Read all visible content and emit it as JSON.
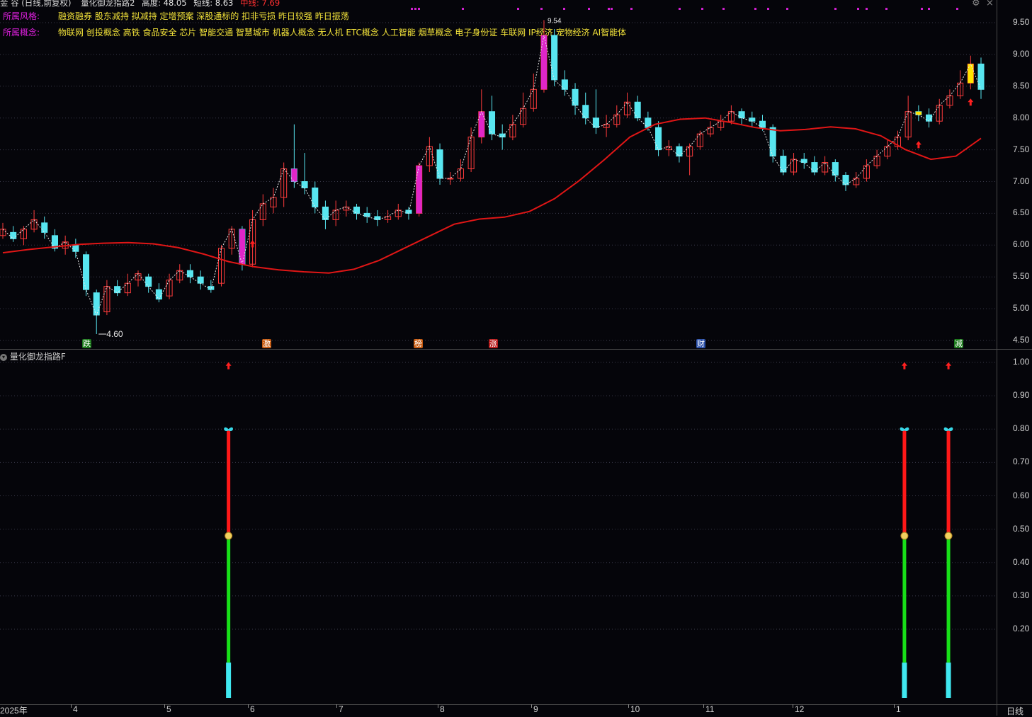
{
  "header": {
    "stock": "金 谷 (日线,前复权)",
    "indicator": "量化御龙指路2",
    "height_label": "高度: 48.05",
    "short_label": "短线: 8.63",
    "mid_label": "中线: 7.69"
  },
  "style_row": {
    "label": "所属风格:",
    "text": "融资融券 股东减持 拟减持 定增预案 深股通标的 扣非亏损 昨日较强 昨日振荡"
  },
  "concept_row": {
    "label": "所属概念:",
    "text": "物联网 创投概念 高铁 食品安全 芯片 智能交通 智慧城市 机器人概念 无人机 ETC概念 人工智能 烟草概念 电子身份证 车联网 IP经济 宠物经济 AI智能体"
  },
  "lower_panel": {
    "title": "量化御龙指路F"
  },
  "price_axis": {
    "ticks": [
      "9.50",
      "9.00",
      "8.50",
      "8.00",
      "7.50",
      "7.00",
      "6.50",
      "6.00",
      "5.50",
      "5.00",
      "4.50"
    ]
  },
  "indicator_axis": {
    "ticks": [
      "1.00",
      "0.90",
      "0.80",
      "0.70",
      "0.60",
      "0.50",
      "0.40",
      "0.30",
      "0.20"
    ]
  },
  "date_axis": {
    "labels": [
      "2025年",
      "4",
      "5",
      "6",
      "7",
      "8",
      "9",
      "10",
      "11",
      "12",
      "1"
    ]
  },
  "period": "日线",
  "low_marker": "4.60",
  "high_marker": "9.54",
  "events": [
    {
      "text": "跌",
      "color": "#1c7a1c"
    },
    {
      "text": "激",
      "color": "#c65a10"
    },
    {
      "text": "榜",
      "color": "#c65a10"
    },
    {
      "text": "涨",
      "color": "#b81a1a"
    },
    {
      "text": "财",
      "color": "#2a4fa8"
    },
    {
      "text": "减",
      "color": "#1c7a1c"
    }
  ],
  "colors": {
    "up": "#ff3b3b",
    "down": "#58e6f0",
    "ma": "#e01616",
    "label": "#e020e0",
    "info": "#f2e23a",
    "grid": "#3a3a4a"
  },
  "icons": [
    "gear-icon",
    "close-icon",
    "chevron-down-icon",
    "arrow-up-icon",
    "butterfly-icon",
    "money-bag-icon"
  ],
  "chart_data": {
    "type": "candlestick",
    "ylim": [
      4.45,
      9.75
    ],
    "ma_ylim": [
      4.45,
      9.75
    ],
    "ma": [
      5.88,
      5.93,
      5.97,
      6.01,
      6.03,
      6.04,
      6.02,
      5.96,
      5.86,
      5.74,
      5.66,
      5.61,
      5.58,
      5.56,
      5.62,
      5.76,
      5.95,
      6.14,
      6.33,
      6.41,
      6.44,
      6.53,
      6.73,
      7.02,
      7.35,
      7.7,
      7.9,
      7.98,
      8.0,
      7.93,
      7.85,
      7.8,
      7.82,
      7.86,
      7.83,
      7.72,
      7.5,
      7.35,
      7.4,
      7.68
    ],
    "candles": [
      [
        6.15,
        6.25,
        6.35,
        6.1
      ],
      [
        6.2,
        6.1,
        6.3,
        6.05
      ],
      [
        6.1,
        6.25,
        6.3,
        6.0
      ],
      [
        6.25,
        6.4,
        6.55,
        6.2
      ],
      [
        6.35,
        6.2,
        6.45,
        6.1
      ],
      [
        6.15,
        5.95,
        6.25,
        5.9
      ],
      [
        5.95,
        6.05,
        6.15,
        5.85
      ],
      [
        6.0,
        5.9,
        6.1,
        5.8
      ],
      [
        5.85,
        5.3,
        5.9,
        5.2
      ],
      [
        5.25,
        4.9,
        5.3,
        4.6
      ],
      [
        4.95,
        5.35,
        5.45,
        4.9
      ],
      [
        5.35,
        5.25,
        5.45,
        5.2
      ],
      [
        5.25,
        5.4,
        5.55,
        5.2
      ],
      [
        5.45,
        5.55,
        5.6,
        5.35
      ],
      [
        5.5,
        5.35,
        5.55,
        5.25
      ],
      [
        5.3,
        5.15,
        5.4,
        5.1
      ],
      [
        5.2,
        5.45,
        5.55,
        5.15
      ],
      [
        5.45,
        5.6,
        5.7,
        5.4
      ],
      [
        5.6,
        5.5,
        5.7,
        5.4
      ],
      [
        5.5,
        5.4,
        5.6,
        5.3
      ],
      [
        5.35,
        5.3,
        5.45,
        5.25
      ],
      [
        5.4,
        5.95,
        6.0,
        5.35
      ],
      [
        5.95,
        6.25,
        6.3,
        5.85
      ],
      [
        6.25,
        5.7,
        6.3,
        5.6
      ],
      [
        5.7,
        6.4,
        6.55,
        5.65
      ],
      [
        6.4,
        6.65,
        6.8,
        6.3
      ],
      [
        6.6,
        6.75,
        6.9,
        6.5
      ],
      [
        6.75,
        7.2,
        7.3,
        6.6
      ],
      [
        7.2,
        7.0,
        7.9,
        6.9
      ],
      [
        7.0,
        6.9,
        7.45,
        6.8
      ],
      [
        6.9,
        6.6,
        7.0,
        6.5
      ],
      [
        6.6,
        6.4,
        6.7,
        6.25
      ],
      [
        6.4,
        6.55,
        6.7,
        6.3
      ],
      [
        6.55,
        6.6,
        6.7,
        6.45
      ],
      [
        6.6,
        6.5,
        6.65,
        6.4
      ],
      [
        6.5,
        6.45,
        6.6,
        6.35
      ],
      [
        6.45,
        6.4,
        6.55,
        6.3
      ],
      [
        6.4,
        6.45,
        6.55,
        6.35
      ],
      [
        6.45,
        6.55,
        6.65,
        6.4
      ],
      [
        6.55,
        6.5,
        6.6,
        6.4
      ],
      [
        6.5,
        7.25,
        7.3,
        6.45
      ],
      [
        7.25,
        7.55,
        7.7,
        7.15
      ],
      [
        7.5,
        7.05,
        7.6,
        6.95
      ],
      [
        7.05,
        7.05,
        7.15,
        6.95
      ],
      [
        7.05,
        7.2,
        7.35,
        7.0
      ],
      [
        7.2,
        7.7,
        7.85,
        7.15
      ],
      [
        7.7,
        8.1,
        8.45,
        7.6
      ],
      [
        8.1,
        7.75,
        8.35,
        7.65
      ],
      [
        7.75,
        7.7,
        7.9,
        7.5
      ],
      [
        7.7,
        7.9,
        8.05,
        7.65
      ],
      [
        7.9,
        8.15,
        8.4,
        7.85
      ],
      [
        8.15,
        8.45,
        8.7,
        8.1
      ],
      [
        8.45,
        9.3,
        9.54,
        8.4
      ],
      [
        9.3,
        8.6,
        9.4,
        8.5
      ],
      [
        8.6,
        8.45,
        8.75,
        8.35
      ],
      [
        8.45,
        8.2,
        8.55,
        8.05
      ],
      [
        8.2,
        8.0,
        8.4,
        7.9
      ],
      [
        8.0,
        7.85,
        8.45,
        7.75
      ],
      [
        7.85,
        7.9,
        8.05,
        7.7
      ],
      [
        7.9,
        8.05,
        8.2,
        7.85
      ],
      [
        8.05,
        8.25,
        8.4,
        8.0
      ],
      [
        8.25,
        8.0,
        8.35,
        7.95
      ],
      [
        8.0,
        7.85,
        8.1,
        7.8
      ],
      [
        7.85,
        7.5,
        7.95,
        7.4
      ],
      [
        7.5,
        7.55,
        7.65,
        7.4
      ],
      [
        7.55,
        7.4,
        7.6,
        7.3
      ],
      [
        7.4,
        7.55,
        7.6,
        7.1
      ],
      [
        7.55,
        7.75,
        7.8,
        7.5
      ],
      [
        7.75,
        7.85,
        7.95,
        7.7
      ],
      [
        7.85,
        7.95,
        8.05,
        7.8
      ],
      [
        7.95,
        8.1,
        8.2,
        7.9
      ],
      [
        8.1,
        8.0,
        8.15,
        7.9
      ],
      [
        8.0,
        7.95,
        8.1,
        7.85
      ],
      [
        7.95,
        7.85,
        8.05,
        7.8
      ],
      [
        7.85,
        7.4,
        7.9,
        7.3
      ],
      [
        7.4,
        7.15,
        7.5,
        7.1
      ],
      [
        7.15,
        7.35,
        7.45,
        7.1
      ],
      [
        7.35,
        7.3,
        7.45,
        7.2
      ],
      [
        7.3,
        7.15,
        7.4,
        7.1
      ],
      [
        7.15,
        7.3,
        7.4,
        7.1
      ],
      [
        7.3,
        7.1,
        7.35,
        7.0
      ],
      [
        7.1,
        6.95,
        7.15,
        6.85
      ],
      [
        6.95,
        7.05,
        7.15,
        6.9
      ],
      [
        7.05,
        7.25,
        7.35,
        7.0
      ],
      [
        7.25,
        7.4,
        7.5,
        7.2
      ],
      [
        7.4,
        7.55,
        7.65,
        7.35
      ],
      [
        7.55,
        7.7,
        7.8,
        7.5
      ],
      [
        7.7,
        8.1,
        8.35,
        7.65
      ],
      [
        8.1,
        8.05,
        8.2,
        7.95
      ],
      [
        8.05,
        7.95,
        8.15,
        7.85
      ],
      [
        7.95,
        8.2,
        8.3,
        7.9
      ],
      [
        8.2,
        8.35,
        8.45,
        8.15
      ],
      [
        8.35,
        8.55,
        8.75,
        8.3
      ],
      [
        8.55,
        8.85,
        8.98,
        8.45
      ],
      [
        8.85,
        8.45,
        8.95,
        8.3
      ]
    ],
    "signals_lower": [
      {
        "x_fraction": 0.23,
        "levels": {
          "cyan": [
            0,
            0.1
          ],
          "green": [
            0.1,
            0.48
          ],
          "red": [
            0.48,
            0.8
          ],
          "arrow": 0.99
        }
      },
      {
        "x_fraction": 0.921,
        "levels": {
          "cyan": [
            0,
            0.1
          ],
          "green": [
            0.1,
            0.48
          ],
          "red": [
            0.48,
            0.8
          ],
          "arrow": 0.99
        }
      },
      {
        "x_fraction": 0.966,
        "levels": {
          "cyan": [
            0,
            0.1
          ],
          "green": [
            0.1,
            0.48
          ],
          "red": [
            0.48,
            0.8
          ],
          "arrow": 0.99
        }
      }
    ],
    "lower_ylim": [
      0.0,
      1.03
    ]
  }
}
